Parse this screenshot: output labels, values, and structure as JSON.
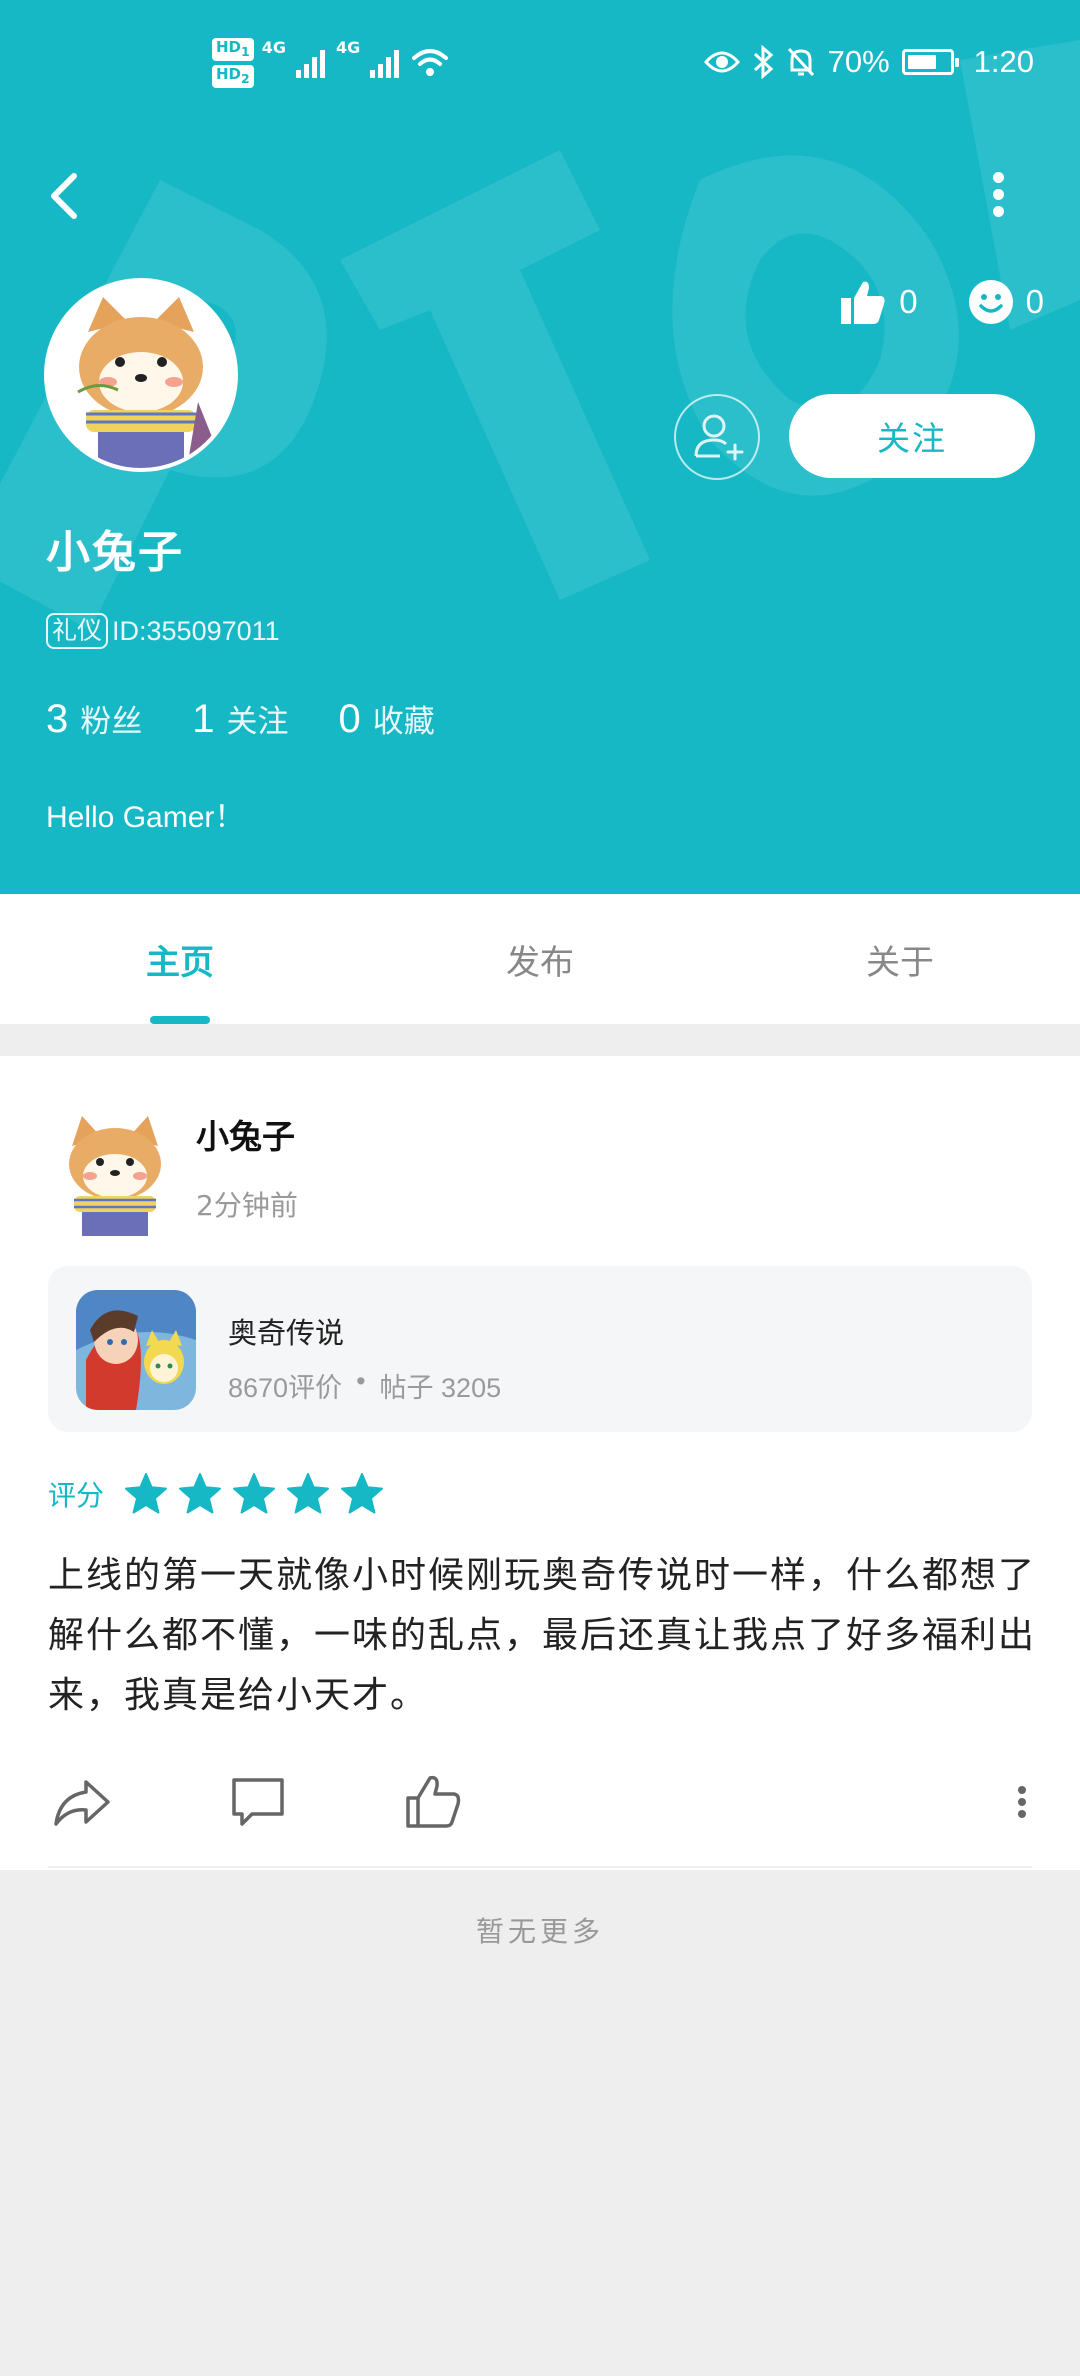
{
  "status_bar": {
    "hd1": "HD",
    "hd1_sub": "1",
    "hd2": "HD",
    "hd2_sub": "2",
    "net1": "4G",
    "net2": "4G",
    "battery_percent": "70%",
    "battery_level": 0.7,
    "time": "1:20",
    "icons": [
      "eye-icon",
      "bluetooth-icon",
      "mute-bell-icon",
      "wifi-icon",
      "signal-icon"
    ]
  },
  "header": {
    "back_icon": "chevron-left-icon",
    "more_icon": "vertical-dots-icon",
    "likes_count": "0",
    "smiles_count": "0",
    "follow_label": "关注",
    "username": "小兔子",
    "badge": "礼仪",
    "id_text": "ID:355097011",
    "fans_count": "3",
    "fans_label": "粉丝",
    "following_count": "1",
    "following_label": "关注",
    "favorites_count": "0",
    "favorites_label": "收藏",
    "bio": "Hello Gamer！",
    "colors": {
      "primary": "#17b8c6"
    }
  },
  "tabs": [
    {
      "label": "主页",
      "active": true
    },
    {
      "label": "发布",
      "active": false
    },
    {
      "label": "关于",
      "active": false
    }
  ],
  "post": {
    "author": "小兔子",
    "time": "2分钟前",
    "game": {
      "name": "奥奇传说",
      "reviews": "8670评价",
      "dot": "•",
      "posts": "帖子 3205"
    },
    "rating_label": "评分",
    "stars": 5,
    "body": "上线的第一天就像小时候刚玩奥奇传说时一样，什么都想了解什么都不懂，一味的乱点，最后还真让我点了好多福利出来，我真是给小天才。"
  },
  "footer": {
    "no_more": "暂无更多"
  }
}
